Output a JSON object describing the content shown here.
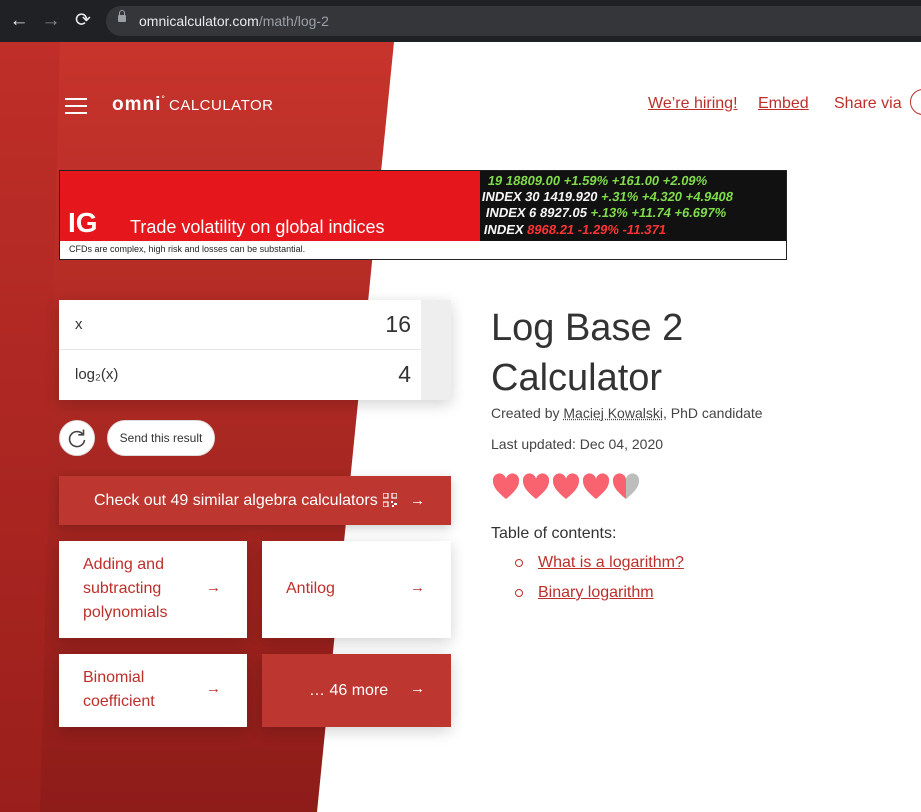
{
  "browser": {
    "url_host": "omnicalculator.com",
    "url_path": "/math/log-2"
  },
  "header": {
    "logo_main": "omni",
    "logo_sub": "CALCULATOR",
    "hiring_link": "We’re hiring!",
    "embed_link": "Embed",
    "share_label": "Share via"
  },
  "ad": {
    "logo": "IG",
    "headline": "Trade volatility on global indices",
    "disclaimer": "CFDs are complex, high risk and losses can be substantial."
  },
  "calculator": {
    "rows": [
      {
        "label": "x",
        "value": "16"
      },
      {
        "label": "log₂(x)",
        "value": "4"
      }
    ],
    "send_result": "Send this result",
    "similar": "Check out 49 similar algebra calculators"
  },
  "related": {
    "tile1": [
      "Adding and",
      "subtracting",
      "polynomials"
    ],
    "tile2": "Antilog",
    "tile3": [
      "Binomial",
      "coefficient"
    ],
    "more": "… 46 more"
  },
  "article": {
    "title_line1": "Log Base 2",
    "title_line2": "Calculator",
    "created_prefix": "Created by",
    "author": "Maciej Kowalski",
    "author_suffix": ", PhD candidate",
    "last_updated": "Last updated: Dec 04, 2020",
    "rating": 4.5,
    "toc_title": "Table of contents:",
    "toc": [
      "What is a logarithm?",
      "Binary logarithm"
    ]
  },
  "colors": {
    "brand_red": "#bd2f2a",
    "heart": "#f8636f"
  },
  "icons": [
    "back-arrow-icon",
    "forward-arrow-icon",
    "reload-icon",
    "lock-icon",
    "hamburger-icon",
    "share-icon",
    "qr-code-icon",
    "arrow-right-icon",
    "heart-icon"
  ]
}
